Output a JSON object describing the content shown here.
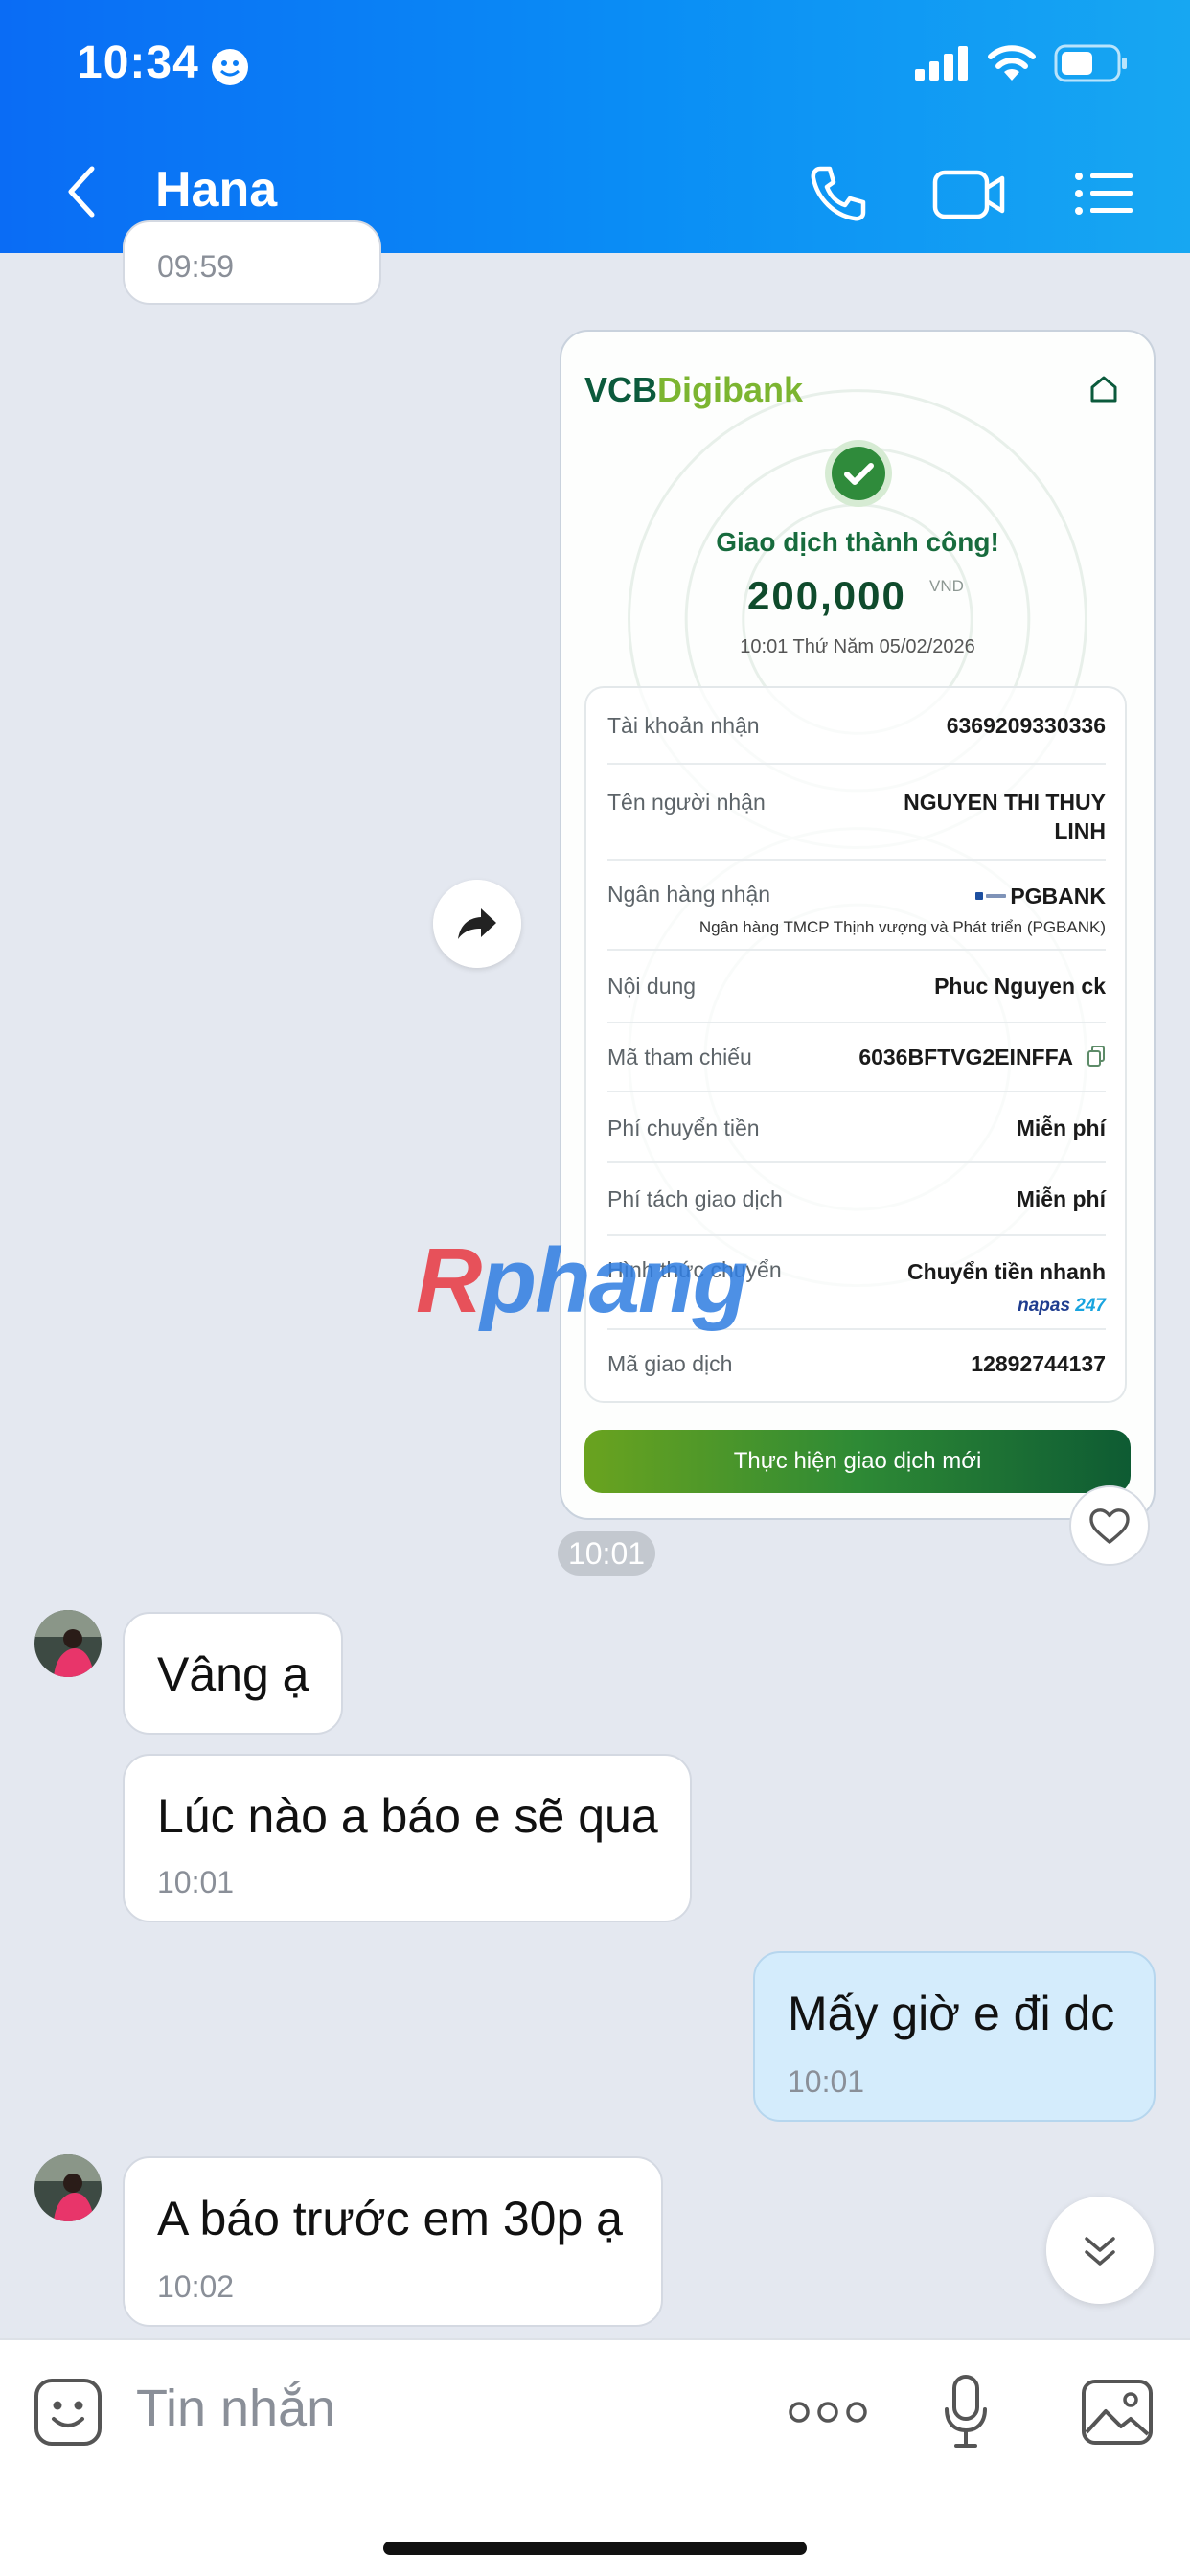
{
  "status_bar": {
    "time": "10:34"
  },
  "header": {
    "title": "Hana"
  },
  "messages": {
    "prev_time": "09:59",
    "m1_text": "Vâng ạ",
    "m2_text": "Lúc nào a báo e sẽ qua",
    "m2_time": "10:01",
    "m3_text": "Mấy giờ e đi dc",
    "m3_time": "10:01",
    "m4_text": "A báo trước em 30p ạ",
    "m4_time": "10:02"
  },
  "receipt": {
    "brand_a": "VCB",
    "brand_b": "Digibank",
    "status": "Giao dịch thành công!",
    "amount": "200,000",
    "currency": "VND",
    "datetime": "10:01 Thứ Năm 05/02/2026",
    "rows": [
      {
        "label": "Tài khoản nhận",
        "value": "6369209330336"
      },
      {
        "label": "Tên người nhận",
        "value": "NGUYEN THI THUY",
        "value2": "LINH"
      },
      {
        "label": "Ngân hàng nhận",
        "value": "PGBANK",
        "sub": "Ngân hàng TMCP Thịnh vượng và Phát triển (PGBANK)"
      },
      {
        "label": "Nội dung",
        "value": "Phuc Nguyen ck"
      },
      {
        "label": "Mã tham chiếu",
        "value": "6036BFTVG2EINFFA"
      },
      {
        "label": "Phí chuyển tiền",
        "value": "Miễn phí"
      },
      {
        "label": "Phí tách giao dịch",
        "value": "Miễn phí"
      },
      {
        "label": "Hình thức chuyển",
        "value": "Chuyển tiền nhanh",
        "napas_a": "napas",
        "napas_b": "247"
      },
      {
        "label": "Mã giao dịch",
        "value": "12892744137"
      }
    ],
    "button": "Thực hiện giao dịch mới",
    "time": "10:01"
  },
  "watermark": {
    "r": "R",
    "rest": "phang"
  },
  "composer": {
    "placeholder": "Tin nhắn"
  },
  "colors": {
    "header": "#0a8ef5",
    "sent_bubble": "#d4ecfc",
    "vcb_green": "#0b5a3c"
  }
}
